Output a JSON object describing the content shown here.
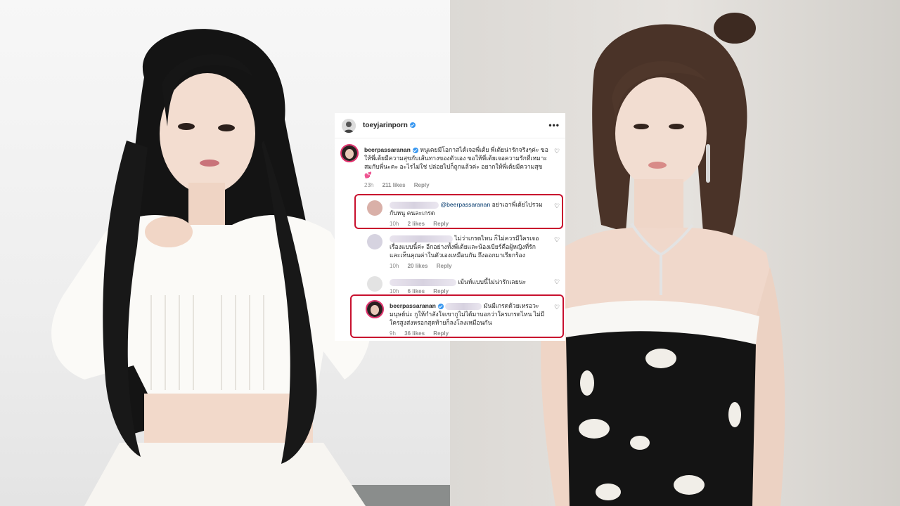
{
  "post": {
    "username": "toeyjarinporn",
    "more_icon": "more-horizontal-icon"
  },
  "comments": [
    {
      "username": "beerpassaranan",
      "text": "หนูเคยมีโอกาสได้เจอพี่เต้ย พี่เต้ยน่ารักจริงๆค่ะ ขอให้พี่เต้ยมีความสุขกับเส้นทางของตัวเอง ขอให้พี่เต้ยเจอความรักที่เหมาะสมกับพี่นะคะ อะไรไม่ใช่ ปล่อยไปก็ถูกแล้วค่ะ อยากให้พี่เต้ยมีความสุข💕",
      "time": "23h",
      "likes": "211 likes",
      "reply": "Reply"
    },
    {
      "username": "",
      "mention": "@beerpassaranan",
      "text": "อย่าเอาพี่เต้ยไปรวมกับหนู คนละเกรด",
      "time": "10h",
      "likes": "2 likes",
      "reply": "Reply"
    },
    {
      "username": "",
      "text": "ไม่ว่าเกรดไหน ก็ไม่ควรมีใครเจอเรื่องแบบนี้ค่ะ อีกอย่างทั้งพี่เต้ยและน้องเบียร์คือผู้หญิงที่รักและเห็นคุณค่าในตัวเองเหมือนกัน ถึงออกมาเรียกร้อง",
      "time": "10h",
      "likes": "20 likes",
      "reply": "Reply"
    },
    {
      "username": "",
      "text": "เม้นท์แบบนี้ไม่น่ารักเลยนะ",
      "time": "10h",
      "likes": "6 likes",
      "reply": "Reply"
    },
    {
      "username": "beerpassaranan",
      "text": "มันมีเกรดด้วยเหรอวะ มนุษย์น่ะ กูให้กำลังใจเขากูไม่ได้มาบอกว่าใครเกรดไหน ไม่มีใครสูงส่งหรอกสุดท้ายก็ลงโลงเหมือนกัน",
      "time": "9h",
      "likes": "36 likes",
      "reply": "Reply"
    }
  ],
  "colors": {
    "highlight": "#c8102e",
    "verified": "#3897f0",
    "mention": "#00376b",
    "meta": "#8e8e8e"
  },
  "icons": {
    "heart": "heart-outline-icon",
    "verified": "verified-badge-icon"
  }
}
